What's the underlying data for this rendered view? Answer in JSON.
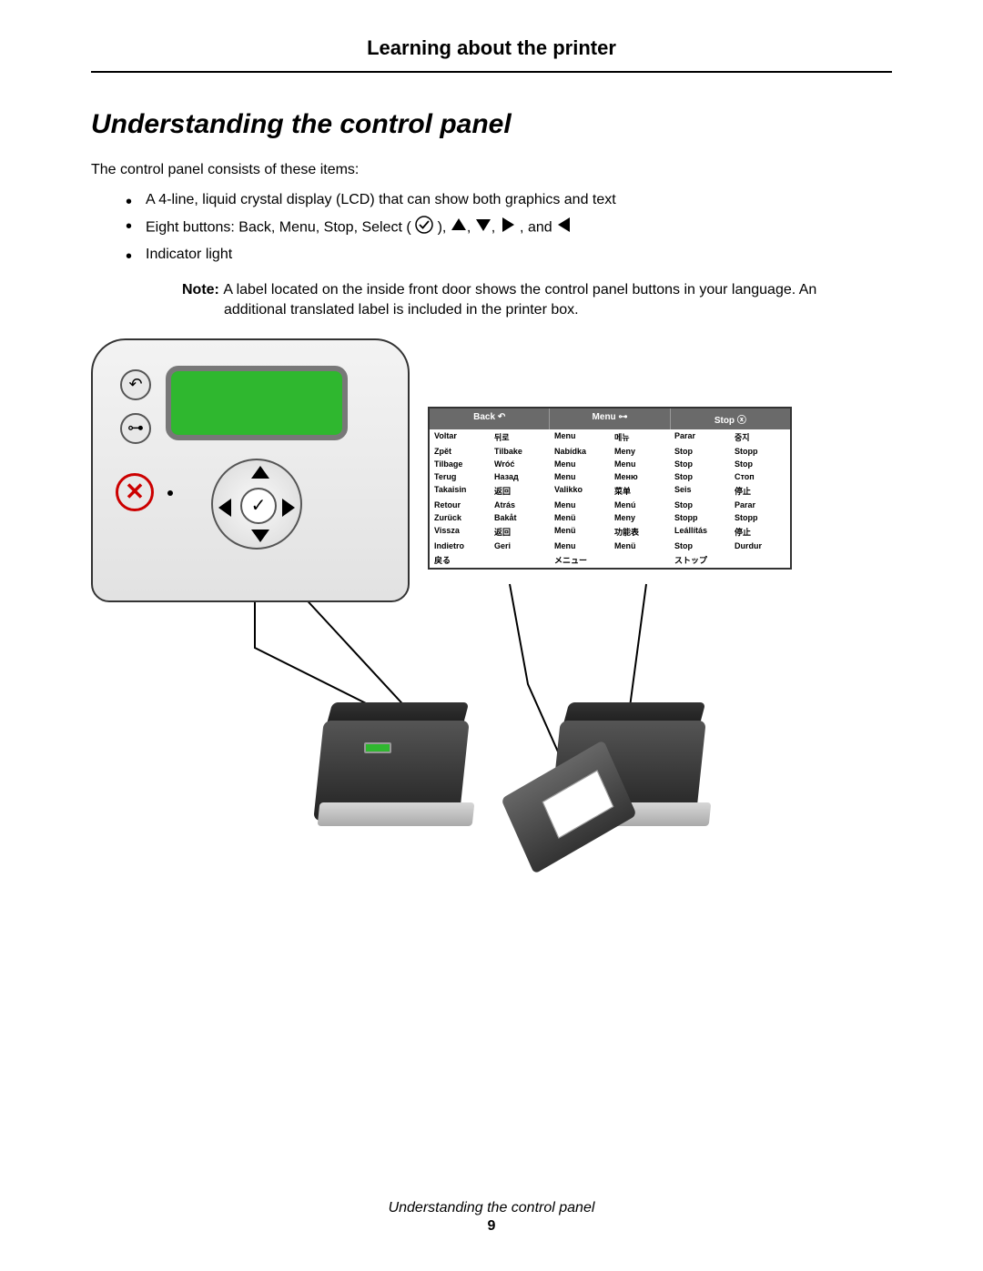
{
  "chapter_title": "Learning about the printer",
  "section_title": "Understanding the control panel",
  "intro_text": "The control panel consists of these items:",
  "bullets": {
    "b1": "A 4-line, liquid crystal display (LCD) that can show both graphics and text",
    "b2_pre": "Eight buttons: Back, Menu, Stop, Select ( ",
    "b2_mid1": " ), ",
    "b2_mid2": ", ",
    "b2_mid3": ", ",
    "b2_mid4": " , and ",
    "b3": "Indicator light"
  },
  "note": {
    "label": "Note: ",
    "text": "A label located on the inside front door shows the control panel buttons in your language. An additional translated label is included in the printer box."
  },
  "lang_headers": {
    "back": "Back",
    "menu": "Menu",
    "stop": "Stop"
  },
  "lang_rows": [
    [
      "Voltar",
      "뒤로",
      "Menu",
      "메뉴",
      "Parar",
      "중지"
    ],
    [
      "Zpět",
      "Tilbake",
      "Nabídka",
      "Meny",
      "Stop",
      "Stopp"
    ],
    [
      "Tilbage",
      "Wróć",
      "Menu",
      "Menu",
      "Stop",
      "Stop"
    ],
    [
      "Terug",
      "Назад",
      "Menu",
      "Меню",
      "Stop",
      "Стоп"
    ],
    [
      "Takaisin",
      "返回",
      "Valikko",
      "菜单",
      "Seis",
      "停止"
    ],
    [
      "Retour",
      "Atrás",
      "Menu",
      "Menú",
      "Stop",
      "Parar"
    ],
    [
      "Zurück",
      "Bakåt",
      "Menü",
      "Meny",
      "Stopp",
      "Stopp"
    ],
    [
      "Vissza",
      "返回",
      "Menü",
      "功能表",
      "Leállítás",
      "停止"
    ],
    [
      "Indietro",
      "Geri",
      "Menu",
      "Menü",
      "Stop",
      "Durdur"
    ],
    [
      "戻る",
      "",
      "メニュー",
      "",
      "ストップ",
      ""
    ]
  ],
  "footer": {
    "text": "Understanding the control panel",
    "page": "9"
  }
}
